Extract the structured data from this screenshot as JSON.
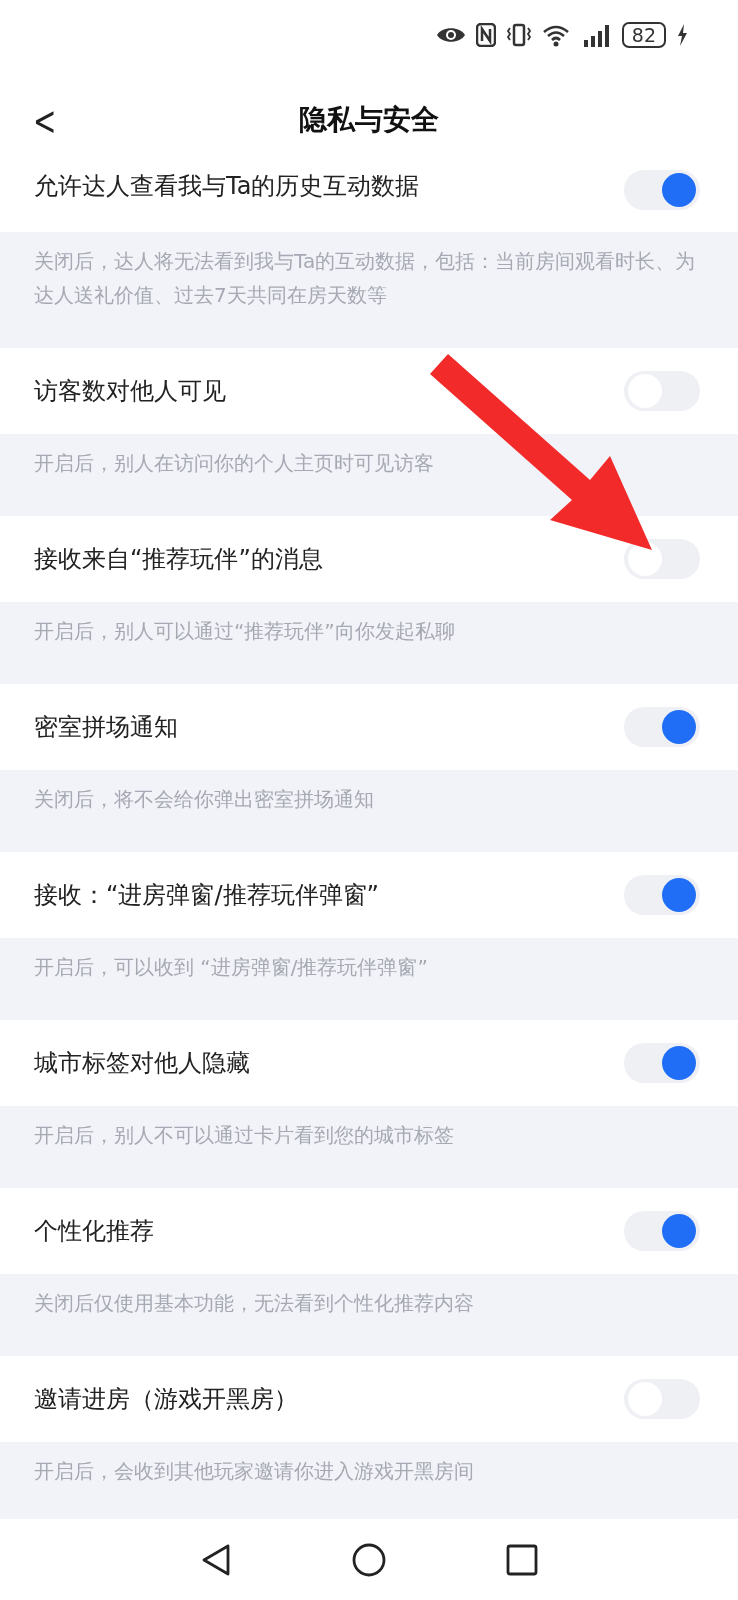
{
  "status_bar": {
    "battery": "82"
  },
  "header": {
    "back": "<",
    "title": "隐私与安全"
  },
  "settings": [
    {
      "label": "允许达人查看我与Ta的历史互动数据",
      "on": true,
      "description": "关闭后，达人将无法看到我与Ta的互动数据，包括：当前房间观看时长、为达人送礼价值、过去7天共同在房天数等"
    },
    {
      "label": "访客数对他人可见",
      "on": false,
      "description": "开启后，别人在访问你的个人主页时可见访客"
    },
    {
      "label": "接收来自“推荐玩伴”的消息",
      "on": false,
      "description": "开启后，别人可以通过“推荐玩伴”向你发起私聊"
    },
    {
      "label": "密室拼场通知",
      "on": true,
      "description": "关闭后，将不会给你弹出密室拼场通知"
    },
    {
      "label": "接收：“进房弹窗/推荐玩伴弹窗”",
      "on": true,
      "description": "开启后，可以收到 “进房弹窗/推荐玩伴弹窗”"
    },
    {
      "label": "城市标签对他人隐藏",
      "on": true,
      "description": "开启后，别人不可以通过卡片看到您的城市标签"
    },
    {
      "label": "个性化推荐",
      "on": true,
      "description": "关闭后仅使用基本功能，无法看到个性化推荐内容"
    },
    {
      "label": "邀请进房（游戏开黑房）",
      "on": false,
      "description": "开启后，会收到其他玩家邀请你进入游戏开黑房间"
    }
  ]
}
